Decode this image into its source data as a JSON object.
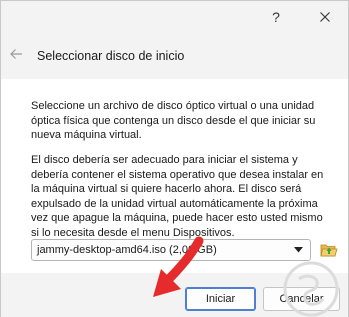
{
  "window": {
    "help_icon": "question-mark-icon",
    "close_icon": "close-icon"
  },
  "header": {
    "back_icon": "back-arrow-icon",
    "title": "Seleccionar disco de inicio"
  },
  "content": {
    "paragraph1": "Seleccione un archivo de disco óptico virtual o una unidad óptica física que contenga un disco desde el que iniciar su nueva máquina virtual.",
    "paragraph2": "El disco debería ser adecuado para iniciar el sistema y debería contener el sistema operativo que desea instalar en la máquina virtual si quiere hacerlo ahora. El disco será expulsado de la unidad virtual automáticamente la próxima vez que apague la máquina, puede hacer esto usted mismo si lo necesita desde el menu Dispositivos.",
    "disk_select": {
      "selected": "jammy-desktop-amd64.iso (2,00 GB)"
    },
    "folder_icon": "folder-open-icon"
  },
  "footer": {
    "start_label": "Iniciar",
    "cancel_label": "Cancelar"
  },
  "colors": {
    "accent": "#4f7fd1",
    "arrow": "#e52b2b",
    "folder": "#e8b84a"
  }
}
